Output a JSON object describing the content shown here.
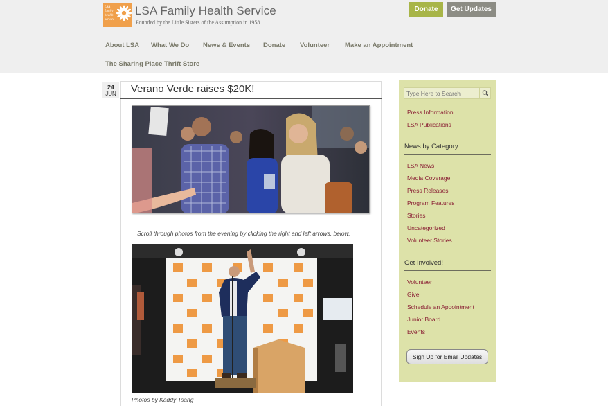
{
  "header": {
    "logo_text": "LSA family health service",
    "site_title": "LSA Family Health Service",
    "tagline": "Founded by the Little Sisters of the Assumption in 1958",
    "donate_label": "Donate",
    "updates_label": "Get Updates"
  },
  "nav": {
    "items": [
      "About LSA",
      "What We Do",
      "News & Events",
      "Donate",
      "Volunteer",
      "Make an Appointment",
      "The Sharing Place Thrift Store"
    ]
  },
  "post": {
    "day": "24",
    "month": "JUN",
    "title": "Verano Verde raises $20K!",
    "caption1": "Scroll through photos from the evening by clicking the right and left arrows, below.",
    "caption2": "Photos by Kaddy Tsang"
  },
  "sidebar": {
    "search_placeholder": "Type Here to Search",
    "top_links": [
      "Press Information",
      "LSA Publications"
    ],
    "news_heading": "News by Category",
    "news_links": [
      "LSA News",
      "Media Coverage",
      "Press Releases",
      "Program Features",
      "Stories",
      "Uncategorized",
      "Volunteer Stories"
    ],
    "involved_heading": "Get Involved!",
    "involved_links": [
      "Volunteer",
      "Give",
      "Schedule an Appointment",
      "Junior Board",
      "Events"
    ],
    "signup_label": "Sign Up for Email Updates"
  },
  "colors": {
    "accent_green": "#a8b548",
    "sidebar_bg": "#dde2a9",
    "link_maroon": "#8a1f34",
    "logo_orange": "#f0a04b"
  }
}
